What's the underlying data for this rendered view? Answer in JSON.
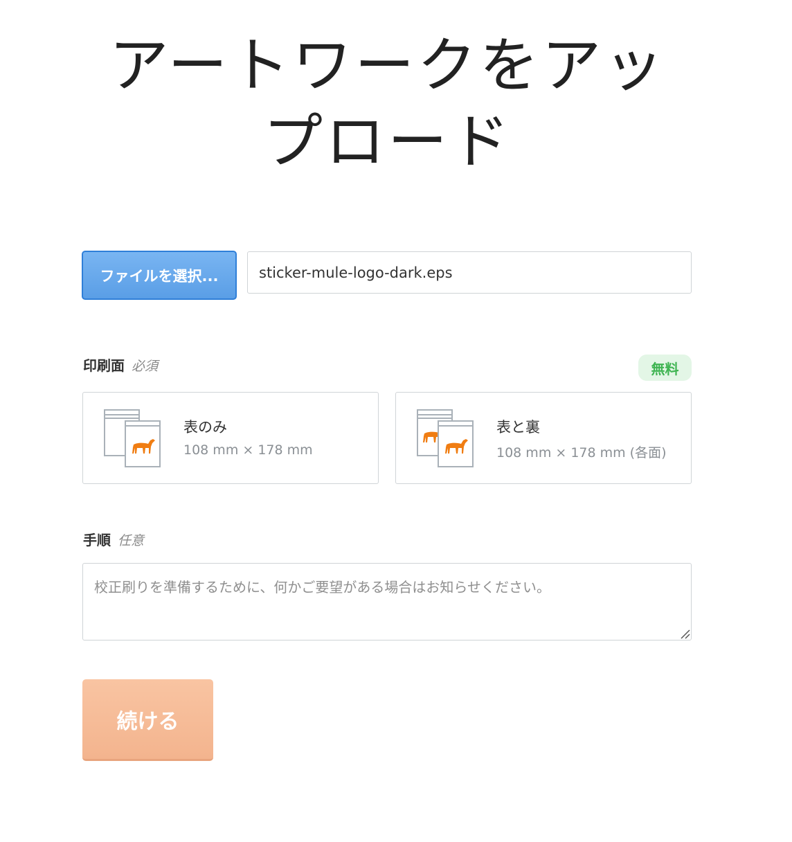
{
  "page": {
    "title": "アートワークをアップロード"
  },
  "upload": {
    "button_label": "ファイルを選択...",
    "file_name": "sticker-mule-logo-dark.eps"
  },
  "print_side": {
    "label": "印刷面",
    "note": "必須",
    "badge": "無料",
    "options": [
      {
        "title": "表のみ",
        "size": "108 mm × 178 mm",
        "icon": "sticker-front-only-icon"
      },
      {
        "title": "表と裏",
        "size": "108 mm × 178 mm (各面)",
        "icon": "sticker-front-and-back-icon"
      }
    ]
  },
  "instructions": {
    "label": "手順",
    "note": "任意",
    "placeholder": "校正刷りを準備するために、何かご要望がある場合はお知らせください。"
  },
  "actions": {
    "continue_label": "続ける"
  },
  "colors": {
    "file_button": "#5a9ee6",
    "continue_button": "#f3b48e",
    "badge_bg": "#e3f6e6",
    "badge_text": "#3fb452",
    "mule_orange": "#f07d12"
  }
}
